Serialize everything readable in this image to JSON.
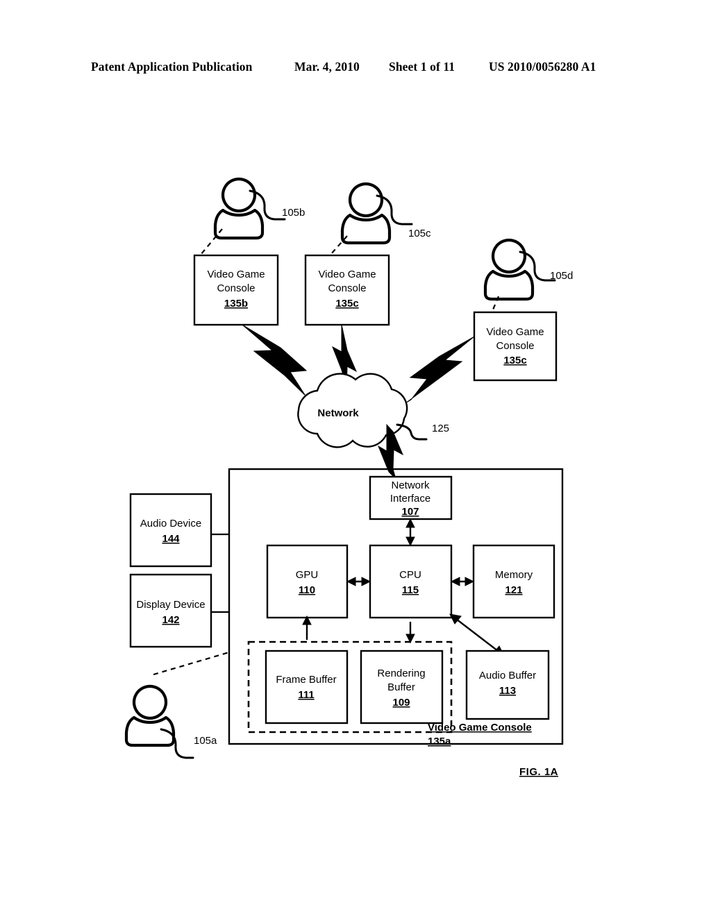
{
  "header": {
    "publication": "Patent Application Publication",
    "date": "Mar. 4, 2010",
    "sheet": "Sheet 1 of 11",
    "number": "US 2010/0056280 A1"
  },
  "figure": {
    "label": "FIG. 1A",
    "cloud": {
      "label": "Network",
      "ref": "125"
    },
    "users": [
      {
        "id": "user-105b",
        "ref": "105b"
      },
      {
        "id": "user-105c",
        "ref": "105c"
      },
      {
        "id": "user-105d",
        "ref": "105d"
      },
      {
        "id": "user-105a",
        "ref": "105a"
      }
    ],
    "remote_consoles": [
      {
        "line1": "Video Game",
        "line2": "Console",
        "ref": "135b"
      },
      {
        "line1": "Video Game",
        "line2": "Console",
        "ref": "135c"
      },
      {
        "line1": "Video Game",
        "line2": "Console",
        "ref": "135c"
      }
    ],
    "main_console": {
      "title": "Video Game Console",
      "ref": "135a",
      "blocks": [
        {
          "id": "network-interface",
          "line1": "Network",
          "line2": "Interface",
          "ref": "107"
        },
        {
          "id": "gpu",
          "line1": "GPU",
          "line2": "",
          "ref": "110"
        },
        {
          "id": "cpu",
          "line1": "CPU",
          "line2": "",
          "ref": "115"
        },
        {
          "id": "memory",
          "line1": "Memory",
          "line2": "",
          "ref": "121"
        },
        {
          "id": "frame-buffer",
          "line1": "Frame Buffer",
          "line2": "",
          "ref": "111"
        },
        {
          "id": "rendering-buffer",
          "line1": "Rendering",
          "line2": "Buffer",
          "ref": "109"
        },
        {
          "id": "audio-buffer",
          "line1": "Audio Buffer",
          "line2": "",
          "ref": "113"
        }
      ]
    },
    "peripherals": [
      {
        "id": "audio-device",
        "line1": "Audio Device",
        "ref": "144"
      },
      {
        "id": "display-device",
        "line1": "Display Device",
        "ref": "142"
      }
    ]
  }
}
